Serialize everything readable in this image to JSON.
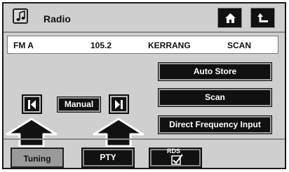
{
  "header": {
    "title": "Radio",
    "app_icon": "music-note-icon",
    "home_icon": "home-icon",
    "back_icon": "return-arrow-icon"
  },
  "station": {
    "band": "FM A",
    "frequency": "105.2",
    "name": "KERRANG",
    "mode": "SCAN"
  },
  "actions": {
    "auto_store": "Auto Store",
    "scan": "Scan",
    "direct_frequency": "Direct Frequency Input"
  },
  "tuning": {
    "prev_icon": "seek-previous-icon",
    "manual_label": "Manual",
    "next_icon": "seek-next-icon"
  },
  "tabs": {
    "tuning": "Tuning",
    "pty": "PTY",
    "rds": "RDS"
  },
  "colors": {
    "panel": "#cfcfcf",
    "button": "#111111",
    "selected_tab": "#9a9a9a"
  }
}
